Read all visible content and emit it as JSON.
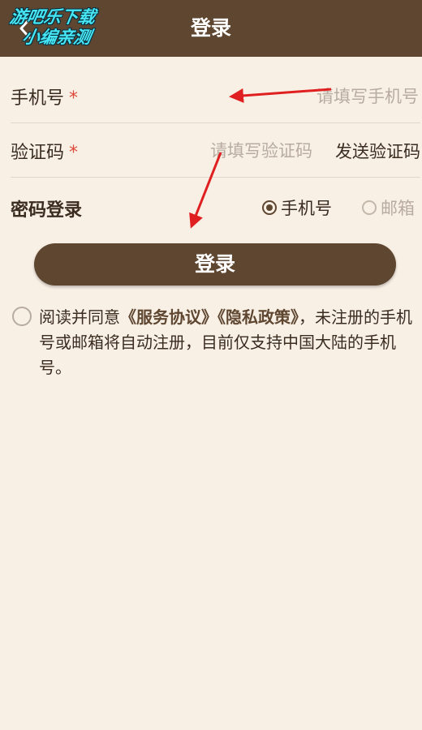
{
  "header": {
    "title": "登录",
    "back_icon": "chevron-left-icon",
    "watermark_line1": "游吧乐下载",
    "watermark_line2": "小编亲测",
    "bg_color": "#5e4630"
  },
  "form": {
    "phone_label": "手机号",
    "required_mark": "*",
    "phone_placeholder": "请填写手机号",
    "code_label": "验证码",
    "code_placeholder": "请填写验证码",
    "send_code": "发送验证码",
    "password_login": "密码登录",
    "radio_phone": "手机号",
    "radio_email": "邮箱",
    "radio_selected": "手机号"
  },
  "login_button": "登录",
  "agreement": {
    "prefix": "阅读并同意",
    "service": "《服务协议》",
    "privacy": "《隐私政策》",
    "suffix": "，未注册的手机号或邮箱将自动注册，目前仅支持中国大陆的手机号。"
  },
  "colors": {
    "accent": "#5e4630",
    "background": "#f8efe5",
    "required": "#e04a3a",
    "annotation_arrow": "#e02020"
  }
}
